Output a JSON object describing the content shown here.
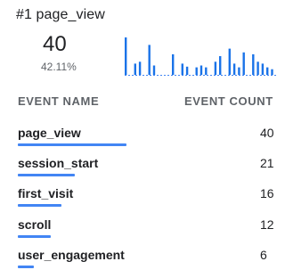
{
  "header": {
    "title": "#1 page_view",
    "value": "40",
    "percent": "42.11%"
  },
  "sparkline": {
    "color": "#1a73e8",
    "baseline_color": "#4285f4",
    "values": [
      1.0,
      0,
      0.3,
      0.35,
      0,
      0.8,
      0.25,
      0,
      0,
      0,
      0.55,
      0,
      0.3,
      0.22,
      0,
      0.2,
      0.25,
      0.2,
      0,
      0.35,
      0.5,
      0,
      0.7,
      0.3,
      0.2,
      0.6,
      0,
      0.55,
      0.35,
      0.3,
      0.2,
      0.15
    ]
  },
  "table": {
    "columns": [
      "EVENT NAME",
      "EVENT COUNT"
    ],
    "bar_color": "#4285f4",
    "rows": [
      {
        "name": "page_view",
        "count": "40",
        "share": 1.0
      },
      {
        "name": "session_start",
        "count": "21",
        "share": 0.525
      },
      {
        "name": "first_visit",
        "count": "16",
        "share": 0.4
      },
      {
        "name": "scroll",
        "count": "12",
        "share": 0.3
      },
      {
        "name": "user_engagement",
        "count": "6",
        "share": 0.15
      }
    ]
  }
}
